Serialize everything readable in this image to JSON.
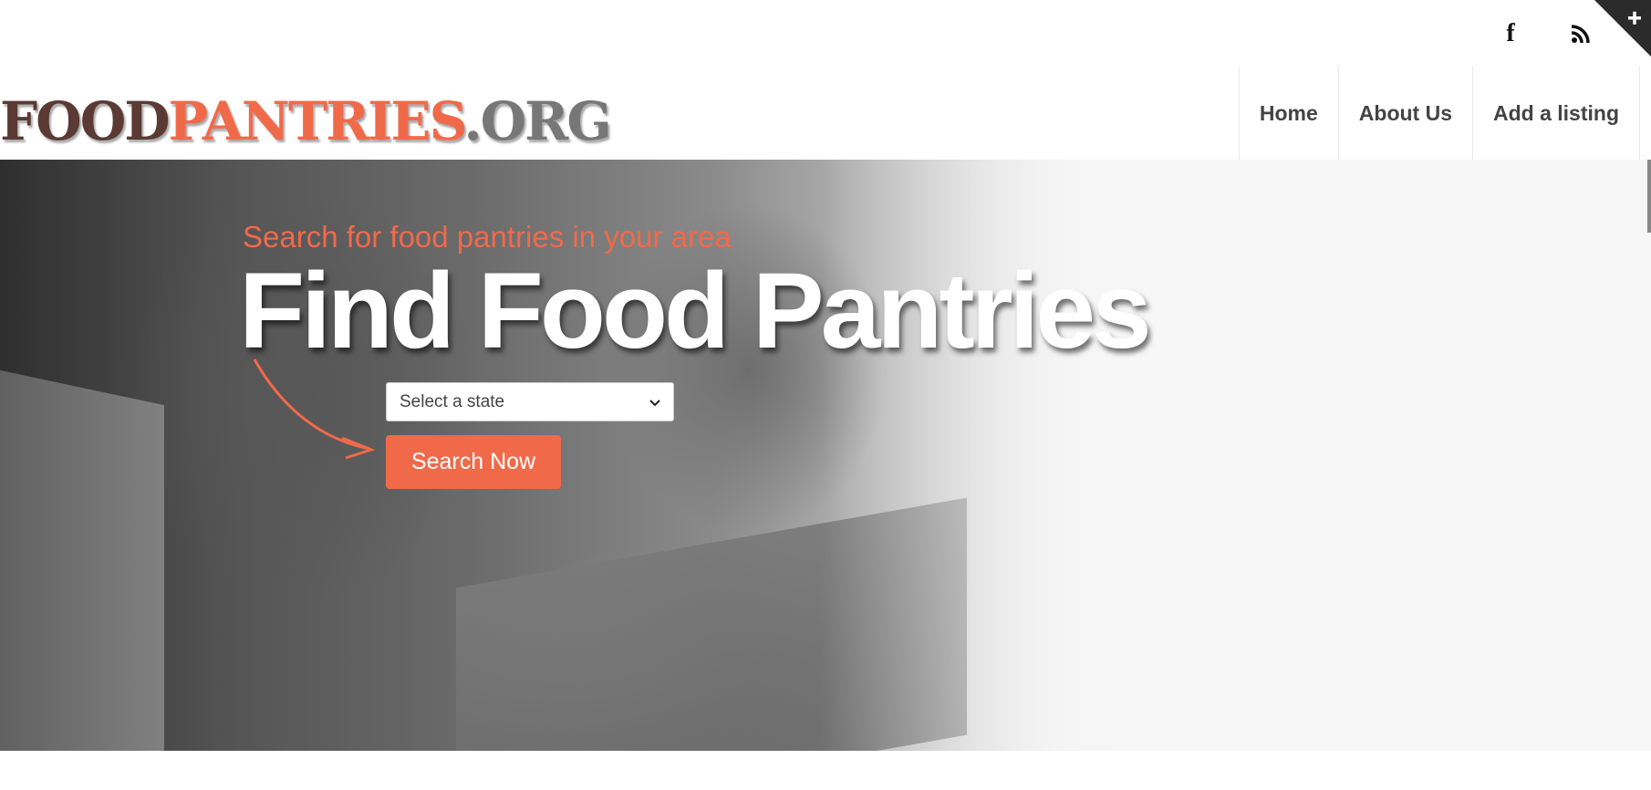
{
  "topbar": {
    "social": [
      {
        "icon": "facebook-icon",
        "label": "f"
      },
      {
        "icon": "rss-icon"
      }
    ],
    "corner_icon": "plus-icon"
  },
  "header": {
    "logo": {
      "part1": "FOOD",
      "part2": "PANTRIES",
      "part3": ".ORG"
    },
    "nav": [
      "Home",
      "About Us",
      "Add a listing"
    ]
  },
  "hero": {
    "subtitle": "Search for food pantries in your area",
    "title": "Find Food Pantries",
    "select_value": "Select a state",
    "button_label": "Search Now"
  },
  "colors": {
    "accent": "#f06a4a",
    "logo_brown": "#5a3a33",
    "logo_gray": "#777777"
  }
}
